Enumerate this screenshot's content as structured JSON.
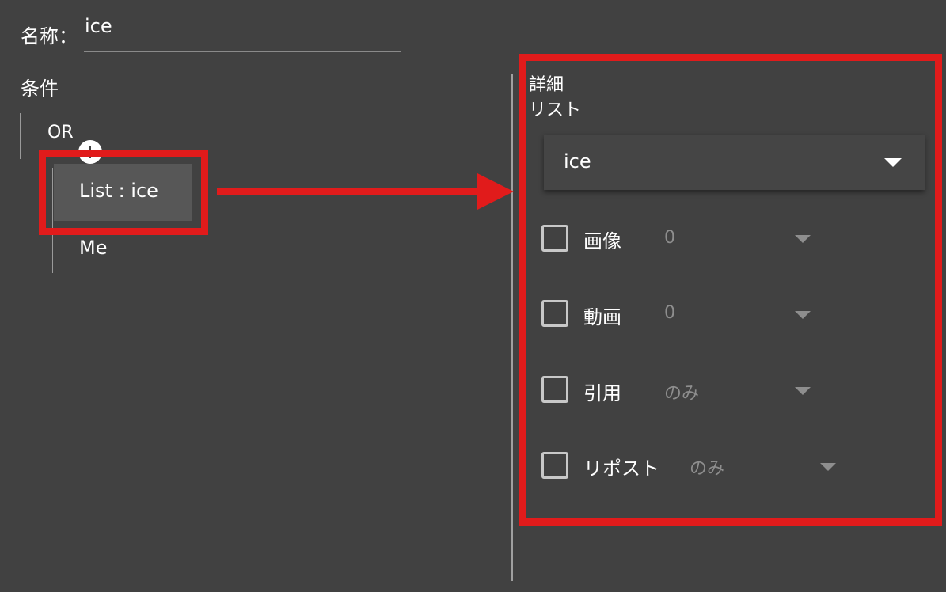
{
  "name": {
    "label": "名称：",
    "value": "ice"
  },
  "conditions": {
    "label": "条件",
    "group_operator": "OR",
    "items": [
      {
        "label": "List : ice",
        "selected": true
      },
      {
        "label": "Me",
        "selected": false
      }
    ]
  },
  "detail": {
    "heading": "詳細",
    "subheading": "リスト",
    "list_select": {
      "value": "ice"
    },
    "options": [
      {
        "label": "画像",
        "value": "0",
        "checked": false
      },
      {
        "label": "動画",
        "value": "0",
        "checked": false
      },
      {
        "label": "引用",
        "value": "のみ",
        "checked": false
      },
      {
        "label": "リポスト",
        "value": "のみ",
        "checked": false
      }
    ]
  },
  "colors": {
    "background": "#414141",
    "annotation_red": "#e11b1b",
    "selected_node": "#575757",
    "muted_text": "#8e8e8e"
  }
}
